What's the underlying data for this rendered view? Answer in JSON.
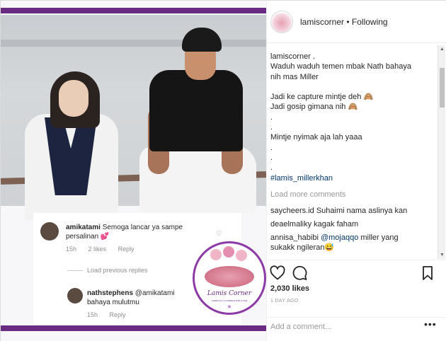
{
  "header": {
    "username": "lamiscorner",
    "separator": "•",
    "follow_status": "Following"
  },
  "caption": {
    "lines": [
      "lamiscorner .",
      "Waduh waduh temen mbak Nath bahaya",
      "nih mas Miller",
      "",
      "Jadi ke capture mintje deh 🙈",
      "Jadi gosip gimana nih 🙈",
      ".",
      ".",
      "Mintje nyimak aja lah yaaa",
      ".",
      ".",
      ".",
      "#lamis_millerkhan"
    ]
  },
  "load_more": "Load more comments",
  "comments": [
    {
      "user": "saycheers.id",
      "text": "Suhaimi nama aslinya kan"
    },
    {
      "user": "deaelmaliky",
      "text": "kagak faham"
    },
    {
      "user": "annisa_habibi",
      "mention": "@mojaqqo",
      "text": "miller yang"
    },
    {
      "user": "",
      "text": "sukakk ngileran😅"
    }
  ],
  "actions": {
    "likes": "2,030 likes",
    "time": "1 DAY AGO",
    "add_comment_placeholder": "Add a comment...",
    "more": "•••"
  },
  "image_overlay": {
    "comment1": {
      "user": "amikatami",
      "text_line1": "Semoga lancar ya sampe",
      "text_line2": "persalinan 💕",
      "time": "15h",
      "likes": "2 likes",
      "reply": "Reply"
    },
    "load_previous": "Load previous replies",
    "comment2": {
      "user": "nathstephens",
      "mention": "@amikatami",
      "text": "bahaya mulutmu",
      "time": "15h",
      "reply": "Reply"
    }
  },
  "badge": {
    "title": "Lamis Corner",
    "tagline": "CAREFULLY & SPREAD WITH LOVE",
    "star": "★"
  },
  "colors": {
    "brand_purple": "#6a2b82",
    "link_blue": "#003569",
    "muted_gray": "#999999"
  }
}
